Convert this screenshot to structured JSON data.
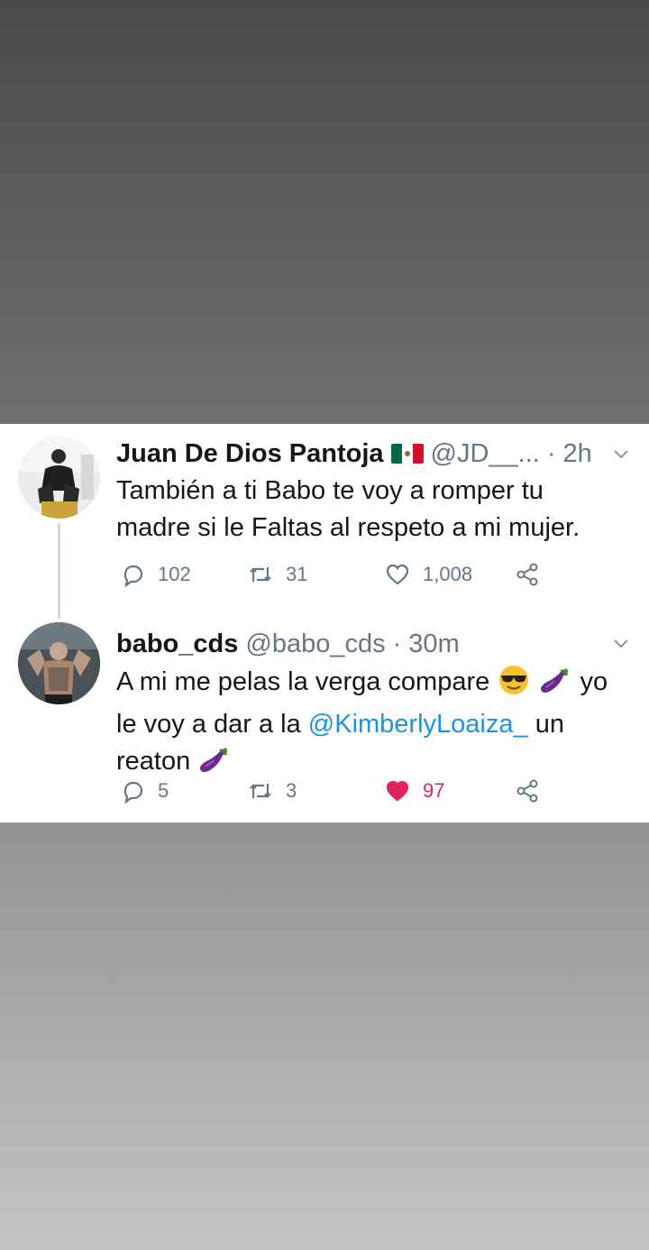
{
  "tweets": [
    {
      "name": "Juan De Dios Pantoja",
      "flag": "mexico-flag-emoji",
      "handle": "@JD__...",
      "time": "· 2h",
      "text": "También a ti Babo te voy a romper tu madre si le Faltas al respeto a mi mujer.",
      "replies": "102",
      "retweets": "31",
      "likes": "1,008",
      "liked": false
    },
    {
      "name": "babo_cds",
      "handle": "@babo_cds",
      "time": "· 30m",
      "text_part1": "A mi me pelas la verga compare",
      "text_part2": "yo le voy a dar a la",
      "mention": "@KimberlyLoaiza_",
      "text_part3": "un reaton",
      "emojis": [
        "smiling-face-with-sunglasses-emoji",
        "eggplant-emoji"
      ],
      "replies": "5",
      "retweets": "3",
      "likes": "97",
      "liked": true
    }
  ],
  "colors": {
    "name": "#14171a",
    "secondary": "#657786",
    "mention": "#1b95e0",
    "like_active": "#e0245e",
    "thread_line": "#cfd9de"
  },
  "icons": [
    "reply-icon",
    "retweet-icon",
    "like-icon",
    "share-icon",
    "chevron-down-icon"
  ]
}
